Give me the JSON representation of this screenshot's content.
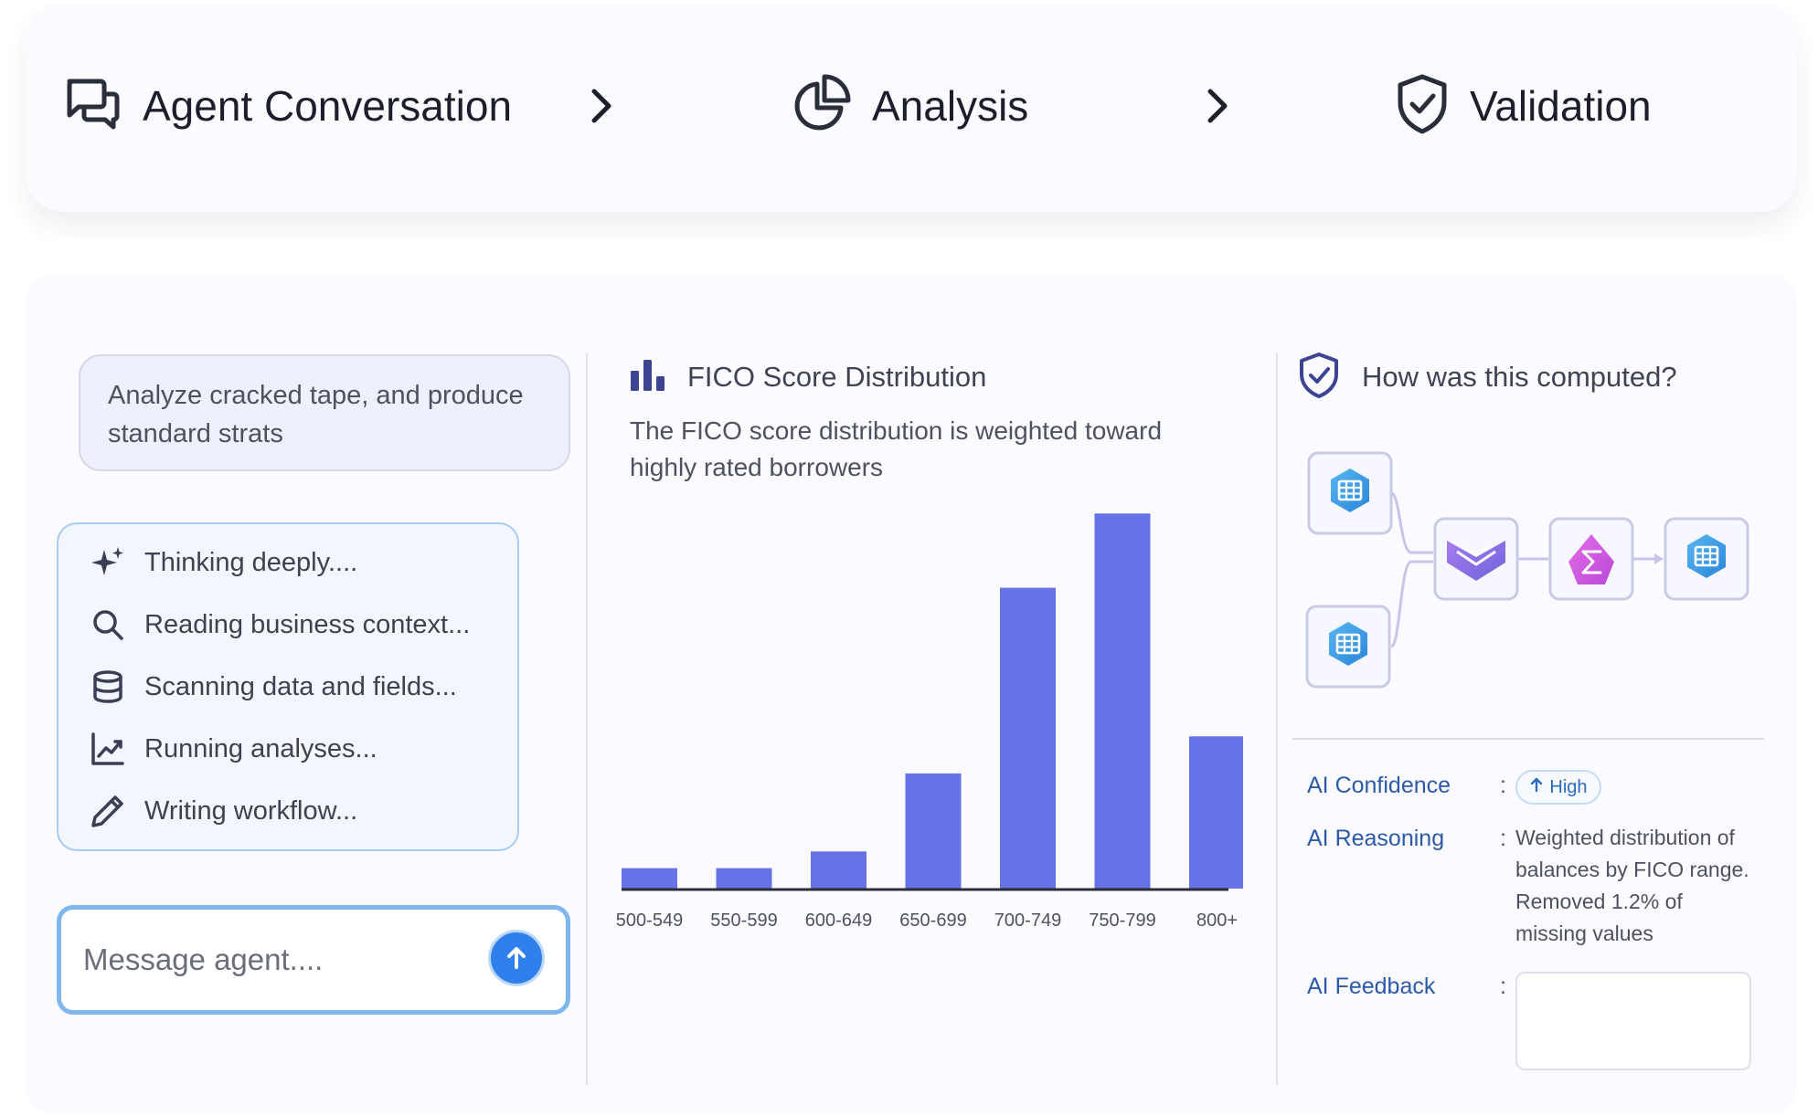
{
  "steps": [
    {
      "label": "Agent Conversation",
      "icon": "chat-bubbles-icon"
    },
    {
      "label": "Analysis",
      "icon": "pie-chart-icon"
    },
    {
      "label": "Validation",
      "icon": "shield-check-icon"
    }
  ],
  "conversation": {
    "prompt": "Analyze cracked tape, and produce standard strats",
    "status_items": [
      {
        "icon": "sparkles-icon",
        "text": "Thinking deeply...."
      },
      {
        "icon": "search-icon",
        "text": "Reading business context..."
      },
      {
        "icon": "database-icon",
        "text": "Scanning data and fields..."
      },
      {
        "icon": "line-chart-icon",
        "text": "Running analyses..."
      },
      {
        "icon": "pencil-icon",
        "text": "Writing workflow..."
      }
    ],
    "input_placeholder": "Message agent....",
    "send_icon": "arrow-up-icon"
  },
  "analysis": {
    "title": "FICO Score Distribution",
    "title_icon": "bar-chart-icon",
    "subtitle": "The FICO score distribution is weighted toward highly rated borrowers",
    "bar_color": "#6672e5"
  },
  "chart_data": {
    "type": "bar",
    "title": "FICO Score Distribution",
    "categories": [
      "500-549",
      "550-599",
      "600-649",
      "650-699",
      "700-749",
      "750-799",
      "800+"
    ],
    "values": [
      5.5,
      5.5,
      10,
      31,
      81,
      101,
      41
    ],
    "ylim": [
      0,
      105
    ],
    "xlabel": "",
    "ylabel": "",
    "grid": false,
    "legend": "none"
  },
  "validation": {
    "title": "How was this computed?",
    "title_icon": "shield-check-icon",
    "flow_nodes": [
      {
        "icon": "table-icon",
        "color": "#3c9be0"
      },
      {
        "icon": "table-icon",
        "color": "#3c9be0"
      },
      {
        "icon": "merge-icon",
        "color": "#8a6ee0"
      },
      {
        "icon": "sigma-icon",
        "color": "#c94fd6"
      },
      {
        "icon": "table-icon",
        "color": "#3c9be0"
      }
    ],
    "confidence_label": "AI Confidence",
    "confidence_value": "High",
    "reasoning_label": "AI Reasoning",
    "reasoning_text": "Weighted distribution of balances by FICO range. Removed 1.2% of missing values",
    "feedback_label": "AI Feedback",
    "colon": ":"
  }
}
